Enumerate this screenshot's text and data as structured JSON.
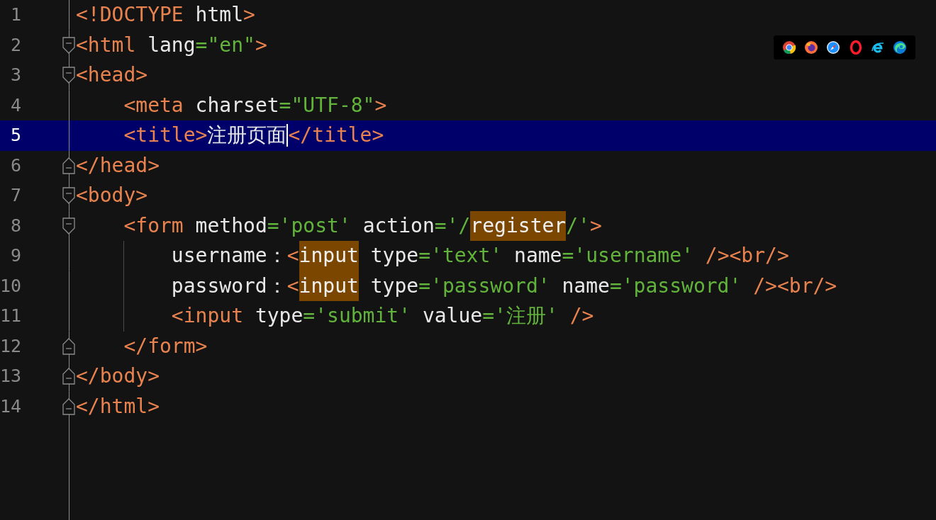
{
  "editor": {
    "lines": [
      {
        "number": "1",
        "current": false,
        "fold_start": false,
        "fold_end": false,
        "tokens": [
          {
            "kind": "tag",
            "text": "<!DOCTYPE"
          },
          {
            "kind": "attr",
            "text": " html"
          },
          {
            "kind": "tag",
            "text": ">"
          }
        ]
      },
      {
        "number": "2",
        "current": false,
        "fold_start": true,
        "fold_end": false,
        "tokens": [
          {
            "kind": "tag",
            "text": "<html"
          },
          {
            "kind": "attr",
            "text": " lang"
          },
          {
            "kind": "str",
            "text": "=\"en\""
          },
          {
            "kind": "tag",
            "text": ">"
          }
        ]
      },
      {
        "number": "3",
        "current": false,
        "fold_start": true,
        "fold_end": false,
        "tokens": [
          {
            "kind": "tag",
            "text": "<head>"
          }
        ]
      },
      {
        "number": "4",
        "current": false,
        "fold_start": false,
        "fold_end": false,
        "tokens": [
          {
            "kind": "tag",
            "text": "    <meta"
          },
          {
            "kind": "attr",
            "text": " charset"
          },
          {
            "kind": "str",
            "text": "=\"UTF-8\""
          },
          {
            "kind": "tag",
            "text": ">"
          }
        ]
      },
      {
        "number": "5",
        "current": true,
        "fold_start": false,
        "fold_end": false,
        "tokens": [
          {
            "kind": "tag",
            "text": "    <title>"
          },
          {
            "kind": "text",
            "text": "注册页面",
            "caret": true
          },
          {
            "kind": "tag",
            "text": "</title>"
          }
        ]
      },
      {
        "number": "6",
        "current": false,
        "fold_start": false,
        "fold_end": true,
        "tokens": [
          {
            "kind": "tag",
            "text": "</head>"
          }
        ]
      },
      {
        "number": "7",
        "current": false,
        "fold_start": true,
        "fold_end": false,
        "tokens": [
          {
            "kind": "tag",
            "text": "<body>"
          }
        ]
      },
      {
        "number": "8",
        "current": false,
        "fold_start": true,
        "fold_end": false,
        "tokens": [
          {
            "kind": "tag",
            "text": "    <form"
          },
          {
            "kind": "attr",
            "text": " method"
          },
          {
            "kind": "str",
            "text": "='post'"
          },
          {
            "kind": "attr",
            "text": " action"
          },
          {
            "kind": "str",
            "text": "='/"
          },
          {
            "kind": "match",
            "text": "register"
          },
          {
            "kind": "str",
            "text": "/'"
          },
          {
            "kind": "tag",
            "text": ">"
          }
        ]
      },
      {
        "number": "9",
        "current": false,
        "fold_start": false,
        "fold_end": false,
        "tokens": [
          {
            "kind": "text",
            "text": "        username："
          },
          {
            "kind": "tag",
            "text": "<"
          },
          {
            "kind": "match",
            "text": "input"
          },
          {
            "kind": "attr",
            "text": " type"
          },
          {
            "kind": "str",
            "text": "='text'"
          },
          {
            "kind": "attr",
            "text": " name"
          },
          {
            "kind": "str",
            "text": "='username'"
          },
          {
            "kind": "tag",
            "text": " /><br/>"
          }
        ]
      },
      {
        "number": "10",
        "current": false,
        "fold_start": false,
        "fold_end": false,
        "tokens": [
          {
            "kind": "text",
            "text": "        password："
          },
          {
            "kind": "tag",
            "text": "<"
          },
          {
            "kind": "match",
            "text": "input"
          },
          {
            "kind": "attr",
            "text": " type"
          },
          {
            "kind": "str",
            "text": "='password'"
          },
          {
            "kind": "attr",
            "text": " name"
          },
          {
            "kind": "str",
            "text": "='password'"
          },
          {
            "kind": "tag",
            "text": " /><br/>"
          }
        ]
      },
      {
        "number": "11",
        "current": false,
        "fold_start": false,
        "fold_end": false,
        "tokens": [
          {
            "kind": "tag",
            "text": "        <input"
          },
          {
            "kind": "attr",
            "text": " type"
          },
          {
            "kind": "str",
            "text": "='submit'"
          },
          {
            "kind": "attr",
            "text": " value"
          },
          {
            "kind": "str",
            "text": "='注册'"
          },
          {
            "kind": "tag",
            "text": " />"
          }
        ]
      },
      {
        "number": "12",
        "current": false,
        "fold_start": false,
        "fold_end": true,
        "tokens": [
          {
            "kind": "tag",
            "text": "    </form>"
          }
        ]
      },
      {
        "number": "13",
        "current": false,
        "fold_start": false,
        "fold_end": true,
        "tokens": [
          {
            "kind": "tag",
            "text": "</body>"
          }
        ]
      },
      {
        "number": "14",
        "current": false,
        "fold_start": false,
        "fold_end": true,
        "tokens": [
          {
            "kind": "tag",
            "text": "</html>"
          }
        ]
      }
    ]
  },
  "browser_icons": [
    {
      "kind": "chrome"
    },
    {
      "kind": "firefox"
    },
    {
      "kind": "safari"
    },
    {
      "kind": "opera"
    },
    {
      "kind": "ie"
    },
    {
      "kind": "edge"
    }
  ]
}
